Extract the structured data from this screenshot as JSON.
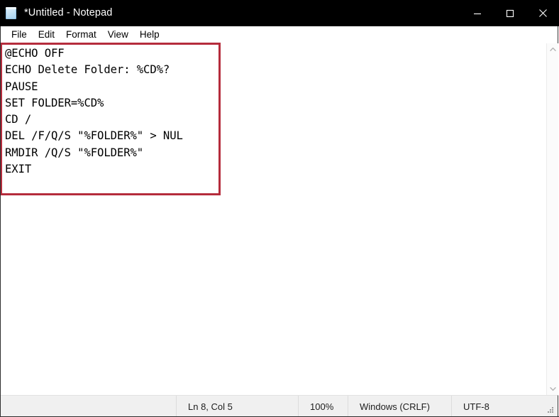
{
  "window": {
    "title": "*Untitled - Notepad",
    "icon": "notepad-icon",
    "titlebar_bg": "#000000",
    "titlebar_fg": "#ffffff",
    "controls": {
      "minimize": "minimize-icon",
      "maximize": "maximize-icon",
      "close": "close-icon"
    }
  },
  "menubar": {
    "items": [
      {
        "label": "File"
      },
      {
        "label": "Edit"
      },
      {
        "label": "Format"
      },
      {
        "label": "View"
      },
      {
        "label": "Help"
      }
    ]
  },
  "editor": {
    "lines": [
      "@ECHO OFF",
      "ECHO Delete Folder: %CD%?",
      "PAUSE",
      "SET FOLDER=%CD%",
      "CD /",
      "DEL /F/Q/S \"%FOLDER%\" > NUL",
      "RMDIR /Q/S \"%FOLDER%\"",
      "EXIT"
    ],
    "content": "@ECHO OFF\nECHO Delete Folder: %CD%?\nPAUSE\nSET FOLDER=%CD%\nCD /\nDEL /F/Q/S \"%FOLDER%\" > NUL\nRMDIR /Q/S \"%FOLDER%\"\nEXIT",
    "placeholder": ""
  },
  "annotation": {
    "color": "#b52c3c",
    "shape": "rectangle-highlight"
  },
  "scrollbar": {
    "up_arrow": "chevron-up-icon",
    "down_arrow": "chevron-down-icon"
  },
  "statusbar": {
    "cursor_position": "Ln 8, Col 5",
    "zoom": "100%",
    "line_ending": "Windows (CRLF)",
    "encoding": "UTF-8",
    "grip": "resize-grip-icon"
  }
}
